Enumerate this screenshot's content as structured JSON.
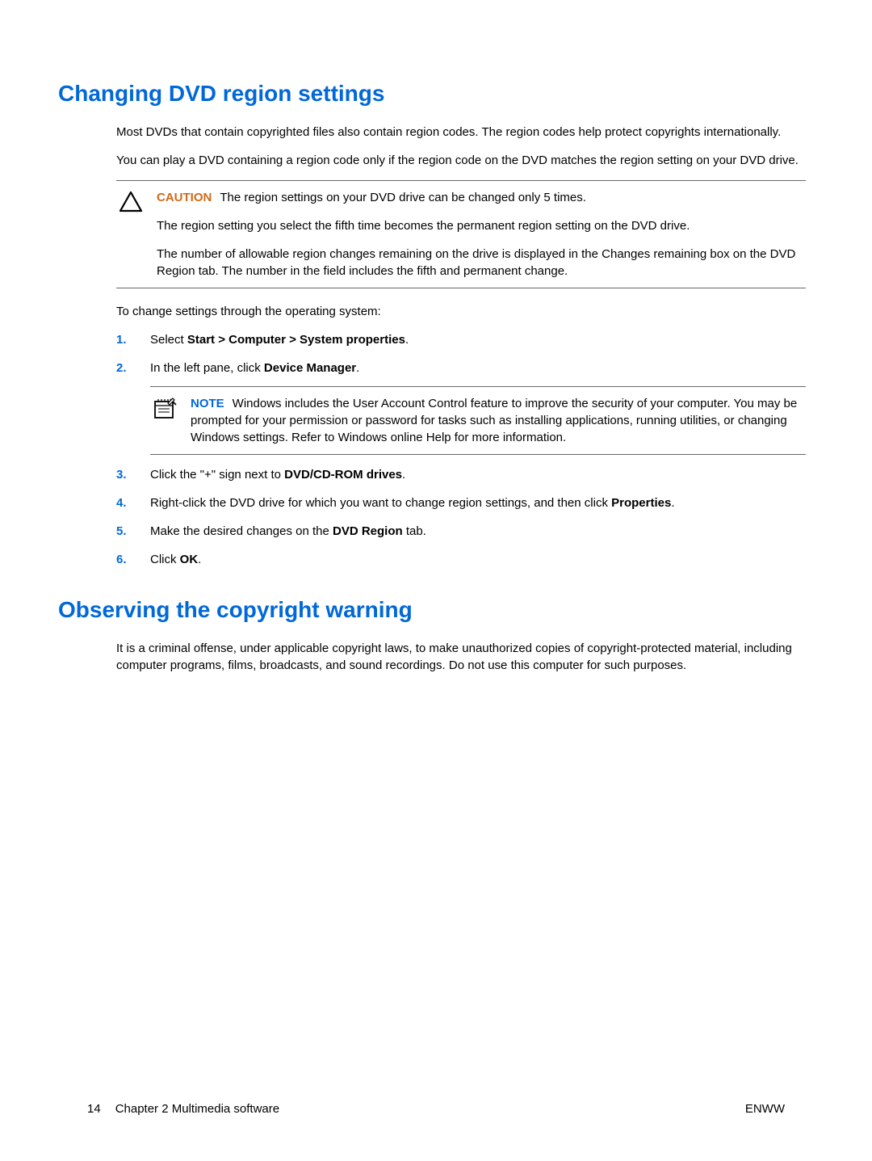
{
  "section1": {
    "heading": "Changing DVD region settings",
    "para1": "Most DVDs that contain copyrighted files also contain region codes. The region codes help protect copyrights internationally.",
    "para2": "You can play a DVD containing a region code only if the region code on the DVD matches the region setting on your DVD drive.",
    "caution": {
      "label": "CAUTION",
      "p1": "The region settings on your DVD drive can be changed only 5 times.",
      "p2": "The region setting you select the fifth time becomes the permanent region setting on the DVD drive.",
      "p3": "The number of allowable region changes remaining on the drive is displayed in the Changes remaining box on the DVD Region tab. The number in the field includes the fifth and permanent change."
    },
    "para3": "To change settings through the operating system:",
    "steps": {
      "s1_pre": "Select ",
      "s1_bold": "Start > Computer > System properties",
      "s1_post": ".",
      "s2_pre": "In the left pane, click ",
      "s2_bold": "Device Manager",
      "s2_post": ".",
      "note": {
        "label": "NOTE",
        "text": "Windows includes the User Account Control feature to improve the security of your computer. You may be prompted for your permission or password for tasks such as installing applications, running utilities, or changing Windows settings. Refer to Windows online Help for more information."
      },
      "s3_pre": "Click the \"+\" sign next to ",
      "s3_bold": "DVD/CD-ROM drives",
      "s3_post": ".",
      "s4_pre": "Right-click the DVD drive for which you want to change region settings, and then click ",
      "s4_bold": "Properties",
      "s4_post": ".",
      "s5_pre": "Make the desired changes on the ",
      "s5_bold": "DVD Region",
      "s5_post": " tab.",
      "s6_pre": "Click ",
      "s6_bold": "OK",
      "s6_post": "."
    }
  },
  "section2": {
    "heading": "Observing the copyright warning",
    "para1": "It is a criminal offense, under applicable copyright laws, to make unauthorized copies of copyright-protected material, including computer programs, films, broadcasts, and sound recordings. Do not use this computer for such purposes."
  },
  "footer": {
    "pagenum": "14",
    "chapter": "Chapter 2   Multimedia software",
    "right": "ENWW"
  }
}
